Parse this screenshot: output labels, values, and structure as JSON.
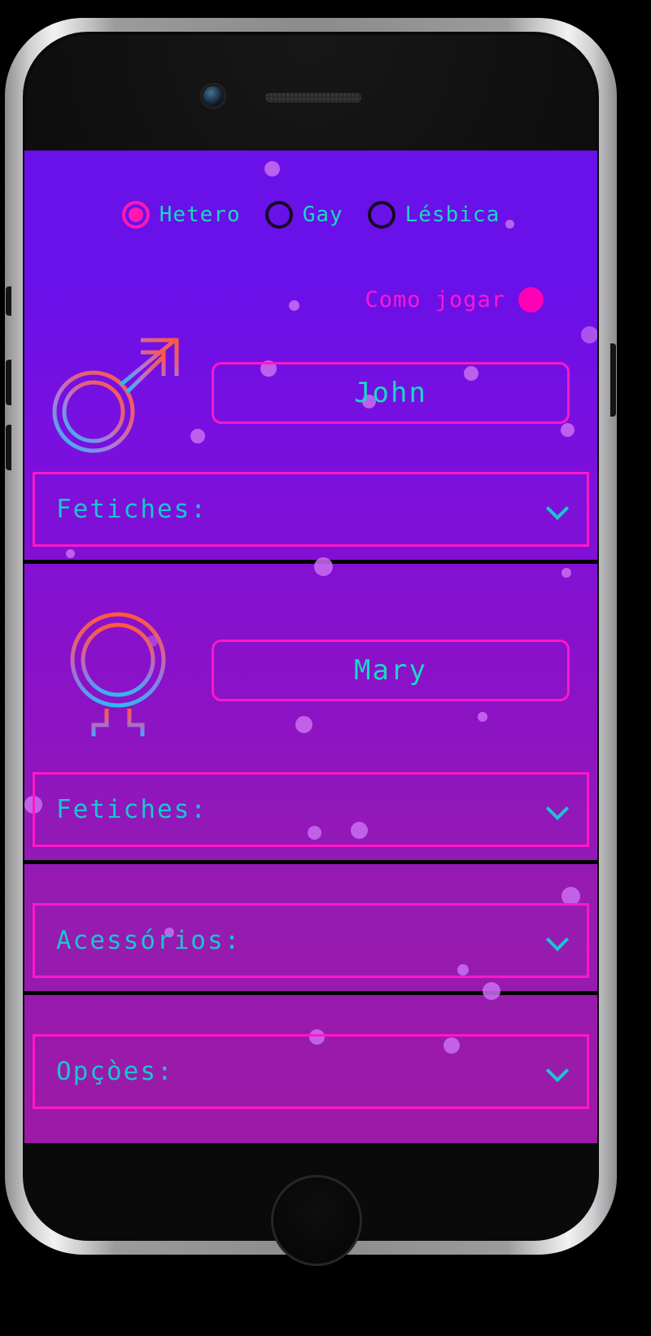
{
  "device": {
    "name": "smartphone-mockup",
    "camera": "camera-icon",
    "speaker": "speaker-grille",
    "home_button": "home-button"
  },
  "app": {
    "orientation": {
      "name": "orientation-radio-group",
      "options": [
        {
          "label": "Hetero",
          "selected": true
        },
        {
          "label": "Gay",
          "selected": false
        },
        {
          "label": "Lésbica",
          "selected": false
        }
      ]
    },
    "how_to_play": {
      "label": "Como jogar",
      "button_icon": "info-dot-icon"
    },
    "players": [
      {
        "symbol": "male-symbol-icon",
        "name_value": "John",
        "name_placeholder": "John",
        "dropdown": {
          "label": "Fetiches:",
          "icon": "chevron-down-icon"
        }
      },
      {
        "symbol": "female-symbol-icon",
        "name_value": "Mary",
        "name_placeholder": "Mary",
        "dropdown": {
          "label": "Fetiches:",
          "icon": "chevron-down-icon"
        }
      }
    ],
    "extra_sections": [
      {
        "label": "Acessórios:",
        "icon": "chevron-down-icon"
      },
      {
        "label": "Opçòes:",
        "icon": "chevron-down-icon"
      }
    ],
    "colors": {
      "accent_magenta": "#ff18c8",
      "accent_pink": "#ff00b4",
      "accent_cyan": "#18d8c4",
      "bg_top": "#6a10e8",
      "bg_bottom": "#9c1aa6",
      "bokeh": "#c96ff0",
      "radio_off": "#140a22",
      "gradient_icon_start": "#ff5a3c",
      "gradient_icon_end": "#2fb8f0"
    }
  }
}
